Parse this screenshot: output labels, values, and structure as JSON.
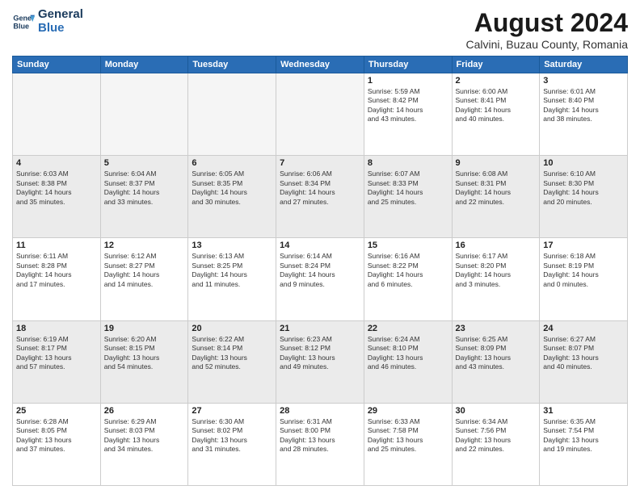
{
  "header": {
    "logo_line1": "General",
    "logo_line2": "Blue",
    "month": "August 2024",
    "location": "Calvini, Buzau County, Romania"
  },
  "weekdays": [
    "Sunday",
    "Monday",
    "Tuesday",
    "Wednesday",
    "Thursday",
    "Friday",
    "Saturday"
  ],
  "rows": [
    {
      "parity": "even",
      "cells": [
        {
          "day": "",
          "info": ""
        },
        {
          "day": "",
          "info": ""
        },
        {
          "day": "",
          "info": ""
        },
        {
          "day": "",
          "info": ""
        },
        {
          "day": "1",
          "info": "Sunrise: 5:59 AM\nSunset: 8:42 PM\nDaylight: 14 hours\nand 43 minutes."
        },
        {
          "day": "2",
          "info": "Sunrise: 6:00 AM\nSunset: 8:41 PM\nDaylight: 14 hours\nand 40 minutes."
        },
        {
          "day": "3",
          "info": "Sunrise: 6:01 AM\nSunset: 8:40 PM\nDaylight: 14 hours\nand 38 minutes."
        }
      ]
    },
    {
      "parity": "odd",
      "cells": [
        {
          "day": "4",
          "info": "Sunrise: 6:03 AM\nSunset: 8:38 PM\nDaylight: 14 hours\nand 35 minutes."
        },
        {
          "day": "5",
          "info": "Sunrise: 6:04 AM\nSunset: 8:37 PM\nDaylight: 14 hours\nand 33 minutes."
        },
        {
          "day": "6",
          "info": "Sunrise: 6:05 AM\nSunset: 8:35 PM\nDaylight: 14 hours\nand 30 minutes."
        },
        {
          "day": "7",
          "info": "Sunrise: 6:06 AM\nSunset: 8:34 PM\nDaylight: 14 hours\nand 27 minutes."
        },
        {
          "day": "8",
          "info": "Sunrise: 6:07 AM\nSunset: 8:33 PM\nDaylight: 14 hours\nand 25 minutes."
        },
        {
          "day": "9",
          "info": "Sunrise: 6:08 AM\nSunset: 8:31 PM\nDaylight: 14 hours\nand 22 minutes."
        },
        {
          "day": "10",
          "info": "Sunrise: 6:10 AM\nSunset: 8:30 PM\nDaylight: 14 hours\nand 20 minutes."
        }
      ]
    },
    {
      "parity": "even",
      "cells": [
        {
          "day": "11",
          "info": "Sunrise: 6:11 AM\nSunset: 8:28 PM\nDaylight: 14 hours\nand 17 minutes."
        },
        {
          "day": "12",
          "info": "Sunrise: 6:12 AM\nSunset: 8:27 PM\nDaylight: 14 hours\nand 14 minutes."
        },
        {
          "day": "13",
          "info": "Sunrise: 6:13 AM\nSunset: 8:25 PM\nDaylight: 14 hours\nand 11 minutes."
        },
        {
          "day": "14",
          "info": "Sunrise: 6:14 AM\nSunset: 8:24 PM\nDaylight: 14 hours\nand 9 minutes."
        },
        {
          "day": "15",
          "info": "Sunrise: 6:16 AM\nSunset: 8:22 PM\nDaylight: 14 hours\nand 6 minutes."
        },
        {
          "day": "16",
          "info": "Sunrise: 6:17 AM\nSunset: 8:20 PM\nDaylight: 14 hours\nand 3 minutes."
        },
        {
          "day": "17",
          "info": "Sunrise: 6:18 AM\nSunset: 8:19 PM\nDaylight: 14 hours\nand 0 minutes."
        }
      ]
    },
    {
      "parity": "odd",
      "cells": [
        {
          "day": "18",
          "info": "Sunrise: 6:19 AM\nSunset: 8:17 PM\nDaylight: 13 hours\nand 57 minutes."
        },
        {
          "day": "19",
          "info": "Sunrise: 6:20 AM\nSunset: 8:15 PM\nDaylight: 13 hours\nand 54 minutes."
        },
        {
          "day": "20",
          "info": "Sunrise: 6:22 AM\nSunset: 8:14 PM\nDaylight: 13 hours\nand 52 minutes."
        },
        {
          "day": "21",
          "info": "Sunrise: 6:23 AM\nSunset: 8:12 PM\nDaylight: 13 hours\nand 49 minutes."
        },
        {
          "day": "22",
          "info": "Sunrise: 6:24 AM\nSunset: 8:10 PM\nDaylight: 13 hours\nand 46 minutes."
        },
        {
          "day": "23",
          "info": "Sunrise: 6:25 AM\nSunset: 8:09 PM\nDaylight: 13 hours\nand 43 minutes."
        },
        {
          "day": "24",
          "info": "Sunrise: 6:27 AM\nSunset: 8:07 PM\nDaylight: 13 hours\nand 40 minutes."
        }
      ]
    },
    {
      "parity": "even",
      "cells": [
        {
          "day": "25",
          "info": "Sunrise: 6:28 AM\nSunset: 8:05 PM\nDaylight: 13 hours\nand 37 minutes."
        },
        {
          "day": "26",
          "info": "Sunrise: 6:29 AM\nSunset: 8:03 PM\nDaylight: 13 hours\nand 34 minutes."
        },
        {
          "day": "27",
          "info": "Sunrise: 6:30 AM\nSunset: 8:02 PM\nDaylight: 13 hours\nand 31 minutes."
        },
        {
          "day": "28",
          "info": "Sunrise: 6:31 AM\nSunset: 8:00 PM\nDaylight: 13 hours\nand 28 minutes."
        },
        {
          "day": "29",
          "info": "Sunrise: 6:33 AM\nSunset: 7:58 PM\nDaylight: 13 hours\nand 25 minutes."
        },
        {
          "day": "30",
          "info": "Sunrise: 6:34 AM\nSunset: 7:56 PM\nDaylight: 13 hours\nand 22 minutes."
        },
        {
          "day": "31",
          "info": "Sunrise: 6:35 AM\nSunset: 7:54 PM\nDaylight: 13 hours\nand 19 minutes."
        }
      ]
    }
  ]
}
